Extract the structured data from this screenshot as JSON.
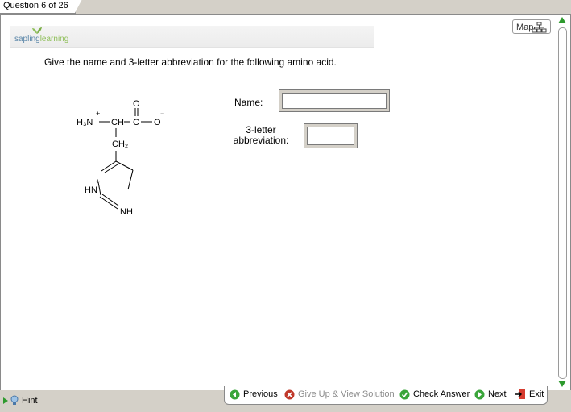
{
  "tab": {
    "label": "Question 6 of 26"
  },
  "logo": {
    "part1": "sapling",
    "part2": "learning"
  },
  "map": {
    "label": "Map"
  },
  "question": {
    "text": "Give the name and 3-letter abbreviation for the following amino acid."
  },
  "structure": {
    "amine": "H₃N",
    "amine_charge": "+",
    "ch": "CH",
    "carbon": "C",
    "carbonyl_o": "O",
    "carboxylate_o": "O",
    "carboxylate_charge": "−",
    "ch2": "CH₂",
    "ring_hn": "HN",
    "ring_hn_charge": "+",
    "ring_nh": "NH"
  },
  "form": {
    "name_label": "Name:",
    "name_value": "",
    "abbr_label_line1": "3-letter",
    "abbr_label_line2": "abbreviation:",
    "abbr_value": ""
  },
  "buttons": {
    "previous": "Previous",
    "giveup": "Give Up & View Solution",
    "check": "Check Answer",
    "next": "Next",
    "exit": "Exit",
    "hint": "Hint"
  },
  "colors": {
    "green": "#2e9a2e",
    "red": "#c0392b",
    "disabled": "#8c8c8c"
  }
}
